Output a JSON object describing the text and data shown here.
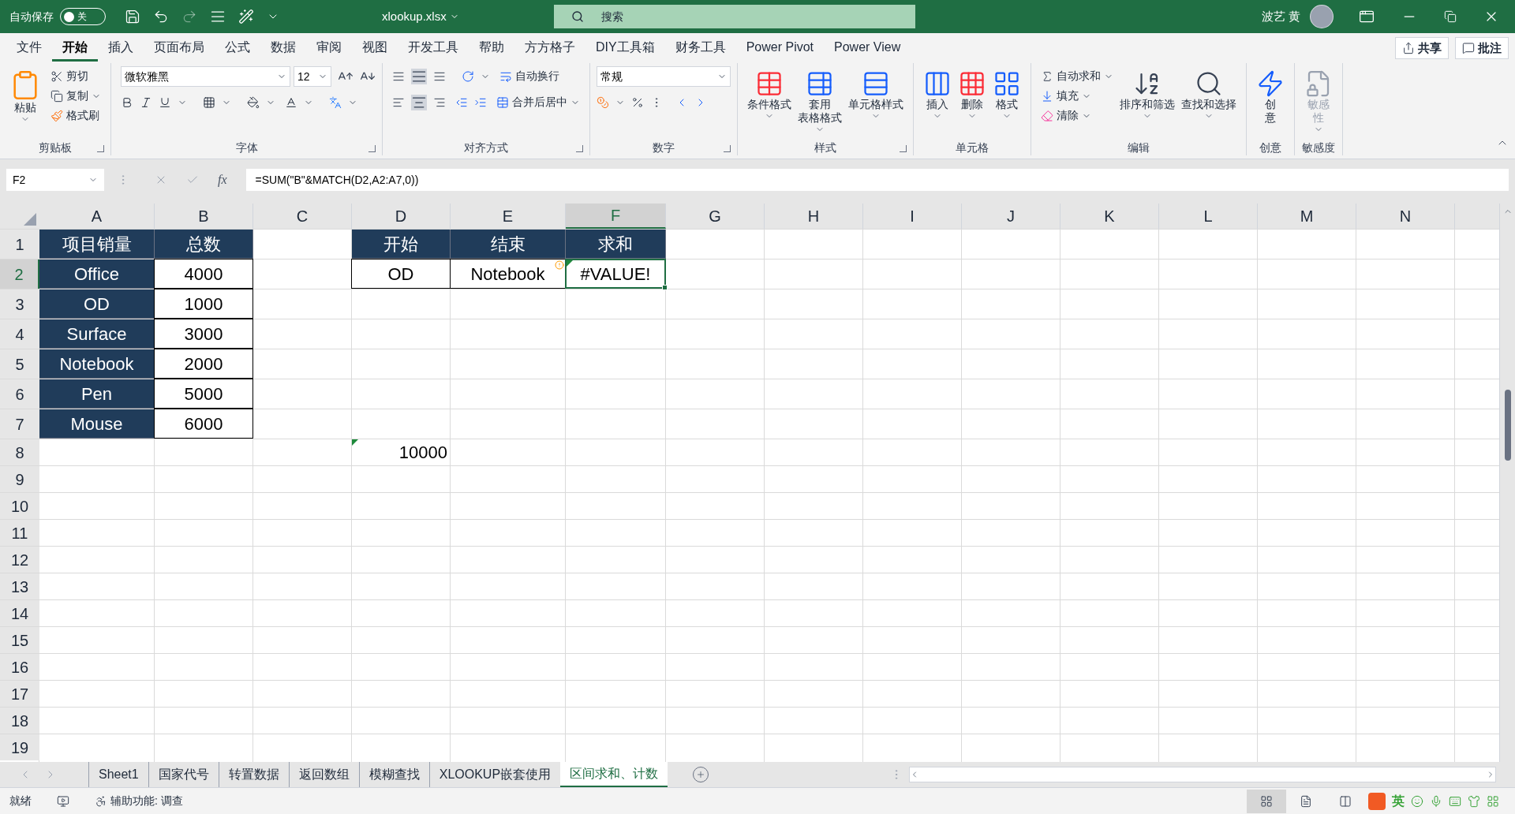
{
  "title_bar": {
    "autosave_label": "自动保存",
    "autosave": {
      "label": "关",
      "on": false
    },
    "filename": "xlookup.xlsx",
    "search_placeholder": "搜索",
    "user": "波艺 黄"
  },
  "menu_tabs": [
    {
      "label": "文件",
      "selected": false
    },
    {
      "label": "开始",
      "selected": true
    },
    {
      "label": "插入",
      "selected": false
    },
    {
      "label": "页面布局",
      "selected": false
    },
    {
      "label": "公式",
      "selected": false
    },
    {
      "label": "数据",
      "selected": false
    },
    {
      "label": "审阅",
      "selected": false
    },
    {
      "label": "视图",
      "selected": false
    },
    {
      "label": "开发工具",
      "selected": false
    },
    {
      "label": "帮助",
      "selected": false
    },
    {
      "label": "方方格子",
      "selected": false
    },
    {
      "label": "DIY工具箱",
      "selected": false
    },
    {
      "label": "财务工具",
      "selected": false
    },
    {
      "label": "Power Pivot",
      "selected": false
    },
    {
      "label": "Power View",
      "selected": false
    }
  ],
  "share_button": "共享",
  "comments_button": "批注",
  "ribbon": {
    "clipboard": {
      "paste": "粘贴",
      "items": [
        "剪切",
        "复制",
        "格式刷"
      ],
      "label": "剪贴板"
    },
    "font": {
      "family": "微软雅黑",
      "size": "12",
      "label": "字体"
    },
    "alignment": {
      "wrap": "自动换行",
      "merge": "合并后居中",
      "label": "对齐方式"
    },
    "number": {
      "format": "常规",
      "label": "数字"
    },
    "styles": {
      "buttons": [
        {
          "lines": [
            "条件格式"
          ]
        },
        {
          "lines": [
            "套用",
            "表格格式"
          ]
        },
        {
          "lines": [
            "单元格样式"
          ]
        }
      ],
      "label": "样式"
    },
    "cells": {
      "buttons": [
        "插入",
        "删除",
        "格式"
      ],
      "label": "单元格"
    },
    "editing": {
      "items": [
        "自动求和",
        "填充",
        "清除"
      ],
      "buttons": [
        "排序和筛选",
        "查找和选择"
      ],
      "label": "编辑"
    },
    "ideas": {
      "lines": [
        "创",
        "意"
      ],
      "label": "创意",
      "disabled": false
    },
    "sensitivity": {
      "lines": [
        "敏感",
        "性"
      ],
      "label": "敏感度",
      "disabled": true
    }
  },
  "formula_bar": {
    "name_box": "F2",
    "fx": "fx",
    "formula": "=SUM(\"B\"&MATCH(D2,A2:A7,0))"
  },
  "sheet": {
    "columns": [
      {
        "label": "A",
        "selected": false
      },
      {
        "label": "B",
        "selected": false
      },
      {
        "label": "C",
        "selected": false
      },
      {
        "label": "D",
        "selected": false
      },
      {
        "label": "E",
        "selected": false
      },
      {
        "label": "F",
        "selected": true
      },
      {
        "label": "G",
        "selected": false
      },
      {
        "label": "H",
        "selected": false
      },
      {
        "label": "I",
        "selected": false
      },
      {
        "label": "J",
        "selected": false
      },
      {
        "label": "K",
        "selected": false
      },
      {
        "label": "L",
        "selected": false
      },
      {
        "label": "M",
        "selected": false
      },
      {
        "label": "N",
        "selected": false
      }
    ],
    "rows": [
      {
        "number": "1",
        "selected": false,
        "cells": [
          {
            "text": "项目销量",
            "kind": "header"
          },
          {
            "text": "总数",
            "kind": "header"
          },
          {
            "kind": "empty"
          },
          {
            "text": "开始",
            "kind": "header"
          },
          {
            "text": "结束",
            "kind": "header"
          },
          {
            "text": "求和",
            "kind": "header"
          }
        ]
      },
      {
        "number": "2",
        "selected": true,
        "cells": [
          {
            "text": "Office",
            "kind": "label"
          },
          {
            "text": "4000",
            "kind": "value"
          },
          {
            "kind": "empty"
          },
          {
            "text": "OD",
            "kind": "value"
          },
          {
            "text": "Notebook",
            "kind": "value",
            "warning": true
          },
          {
            "text": "#VALUE!",
            "kind": "active",
            "flag": true
          }
        ]
      },
      {
        "number": "3",
        "selected": false,
        "cells": [
          {
            "text": "OD",
            "kind": "label"
          },
          {
            "text": "1000",
            "kind": "value"
          }
        ]
      },
      {
        "number": "4",
        "selected": false,
        "cells": [
          {
            "text": "Surface",
            "kind": "label"
          },
          {
            "text": "3000",
            "kind": "value"
          }
        ]
      },
      {
        "number": "5",
        "selected": false,
        "cells": [
          {
            "text": "Notebook",
            "kind": "label"
          },
          {
            "text": "2000",
            "kind": "value"
          }
        ]
      },
      {
        "number": "6",
        "selected": false,
        "cells": [
          {
            "text": "Pen",
            "kind": "label"
          },
          {
            "text": "5000",
            "kind": "value"
          }
        ]
      },
      {
        "number": "7",
        "selected": false,
        "cells": [
          {
            "text": "Mouse",
            "kind": "label"
          },
          {
            "text": "6000",
            "kind": "value"
          }
        ]
      },
      {
        "number": "8",
        "selected": false,
        "cells": [
          {
            "kind": "empty"
          },
          {
            "kind": "empty"
          },
          {
            "kind": "empty"
          },
          {
            "text": "10000",
            "kind": "plain",
            "flag": true
          }
        ]
      },
      {
        "number": "9",
        "selected": false,
        "cells": []
      },
      {
        "number": "10",
        "selected": false,
        "cells": []
      },
      {
        "number": "11",
        "selected": false,
        "cells": []
      },
      {
        "number": "12",
        "selected": false,
        "cells": []
      },
      {
        "number": "13",
        "selected": false,
        "cells": []
      },
      {
        "number": "14",
        "selected": false,
        "cells": []
      },
      {
        "number": "15",
        "selected": false,
        "cells": []
      },
      {
        "number": "16",
        "selected": false,
        "cells": []
      },
      {
        "number": "17",
        "selected": false,
        "cells": []
      },
      {
        "number": "18",
        "selected": false,
        "cells": []
      },
      {
        "number": "19",
        "selected": false,
        "cells": []
      }
    ]
  },
  "sheet_tabs": [
    {
      "label": "Sheet1",
      "selected": false
    },
    {
      "label": "国家代号",
      "selected": false
    },
    {
      "label": "转置数据",
      "selected": false
    },
    {
      "label": "返回数组",
      "selected": false
    },
    {
      "label": "模糊查找",
      "selected": false
    },
    {
      "label": "XLOOKUP嵌套使用",
      "selected": false
    },
    {
      "label": "区间求和、计数",
      "selected": true
    }
  ],
  "status_bar": {
    "status": "就绪",
    "accessibility": "辅助功能: 调查",
    "views": [
      {
        "kind": "normal",
        "selected": true
      },
      {
        "kind": "page",
        "selected": false
      },
      {
        "kind": "break",
        "selected": false
      }
    ],
    "ime_label": "英"
  }
}
